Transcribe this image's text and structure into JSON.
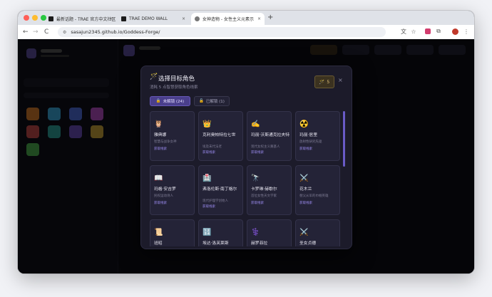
{
  "browser": {
    "tabs": [
      {
        "title": "最新话题 - TRAE 官方中文社区",
        "active": false
      },
      {
        "title": "TRAE DEMO WALL",
        "active": false
      },
      {
        "title": "女神造物 - 女性主义元素示",
        "active": true
      }
    ],
    "new_tab_label": "+",
    "url": "sasajun2345.github.io/Goddess-Forge/",
    "back_label": "←",
    "forward_label": "→",
    "reload_label": "C"
  },
  "modal": {
    "title_icon": "🪄",
    "title": "选择目标角色",
    "subtitle": "消耗 5 点智慧获取角色线索",
    "cost_icon": "🪄",
    "cost_value": "5",
    "close_label": "×",
    "tabs": [
      {
        "icon": "🔒",
        "label": "未解锁 (24)",
        "selected": true
      },
      {
        "icon": "🔓",
        "label": "已解锁 (1)",
        "selected": false
      }
    ],
    "cards": [
      {
        "icon": "🦉",
        "name": "雅典娜",
        "desc": "智慧与战争女神",
        "action": "获取线索"
      },
      {
        "icon": "👑",
        "name": "克利奥帕特拉七世",
        "desc": "埃及末代法老",
        "action": "获取线索"
      },
      {
        "icon": "✍️",
        "name": "玛丽·沃斯通克拉夫特",
        "desc": "现代女权主义奠基人",
        "action": "获取线索"
      },
      {
        "icon": "☢️",
        "name": "玛丽·居里",
        "desc": "放射性研究先驱",
        "action": "获取线索"
      },
      {
        "icon": "📖",
        "name": "玛格·安吉罗",
        "desc": "民权运动诗人",
        "action": "获取线索"
      },
      {
        "icon": "🏥",
        "name": "弗洛伦斯·南丁格尔",
        "desc": "现代护理学创始人",
        "action": "获取线索"
      },
      {
        "icon": "🔭",
        "name": "卡罗琳·赫歇尔",
        "desc": "首位女性天文学家",
        "action": "获取线索"
      },
      {
        "icon": "⚔️",
        "name": "花木兰",
        "desc": "替父从军的巾帼英雄",
        "action": "获取线索"
      },
      {
        "icon": "📜",
        "name": "班昭",
        "desc": "",
        "action": ""
      },
      {
        "icon": "🔢",
        "name": "埃达·洛芙莱斯",
        "desc": "",
        "action": ""
      },
      {
        "icon": "⚕️",
        "name": "赫罗菲拉",
        "desc": "",
        "action": ""
      },
      {
        "icon": "⚔️",
        "name": "圣女贞德",
        "desc": "",
        "action": ""
      }
    ]
  },
  "background": {
    "app_title": "女神造物",
    "colors": {
      "accent": "#6a5bc7",
      "gold": "#e6c47a",
      "panel": "#1c1b2a"
    }
  }
}
